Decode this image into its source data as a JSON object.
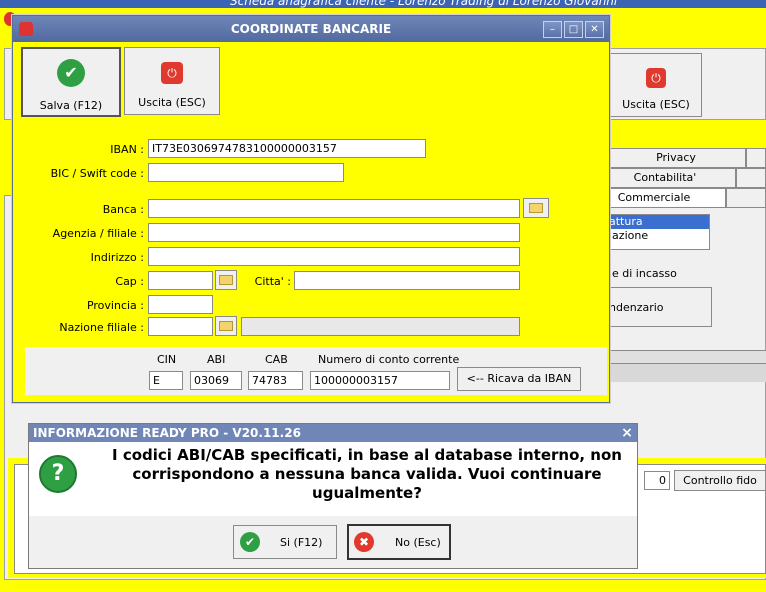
{
  "background_app": {
    "title": "Scheda anagrafica cliente - Lorenzo Trading di Lorenzo Giovanni",
    "exit_label": "Uscita (ESC)",
    "tabs": [
      "Privacy",
      "Contabilita'",
      "Commerciale"
    ],
    "list_items": [
      "attura",
      "iazione"
    ],
    "incasso_text": "e di incasso",
    "scadenzario_label": "ndenzario",
    "fido_value": "0",
    "fido_button": "Controllo fido"
  },
  "dialog": {
    "title": "COORDINATE BANCARIE",
    "save_label": "Salva (F12)",
    "exit_label": "Uscita (ESC)",
    "labels": {
      "iban": "IBAN :",
      "bic": "BIC / Swift code :",
      "banca": "Banca :",
      "agenzia": "Agenzia / filiale :",
      "indirizzo": "Indirizzo :",
      "cap": "Cap :",
      "citta": "Citta' :",
      "provincia": "Provincia :",
      "nazione": "Nazione filiale :"
    },
    "values": {
      "iban": "IT73E0306974783100000003157",
      "bic": "",
      "banca": "",
      "agenzia": "",
      "indirizzo": "",
      "cap": "",
      "citta": "",
      "provincia": "",
      "nazione": ""
    },
    "bank_codes": {
      "cin_label": "CIN",
      "abi_label": "ABI",
      "cab_label": "CAB",
      "conto_label": "Numero di conto corrente",
      "cin": "E",
      "abi": "03069",
      "cab": "74783",
      "conto": "100000003157",
      "derive_button": "<-- Ricava da IBAN"
    }
  },
  "message_box": {
    "title": "INFORMAZIONE READY PRO - V20.11.26",
    "close_glyph": "×",
    "text": "I codici ABI/CAB specificati, in base al database interno, non corrispondono a nessuna banca valida. Vuoi continuare ugualmente?",
    "yes_label": "Si (F12)",
    "no_label": "No (Esc)"
  },
  "colors": {
    "accent": "#ffff00",
    "titlebar": "#6f86b7",
    "ok_green": "#2ea043",
    "stop_red": "#e03a2f"
  }
}
